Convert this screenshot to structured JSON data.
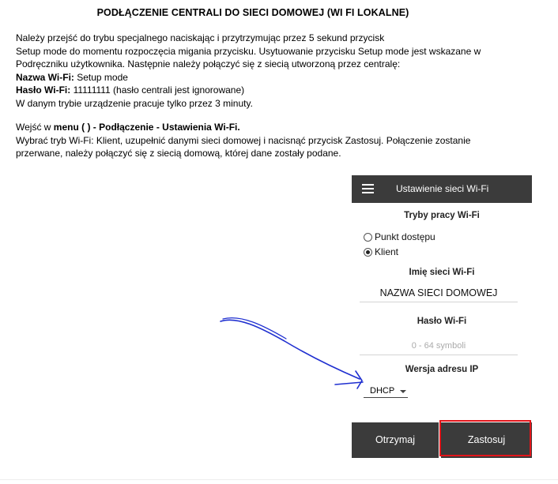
{
  "document": {
    "title": "PODŁĄCZENIE CENTRALI DO SIECI DOMOWEJ (WI FI LOKALNE)",
    "p1": {
      "line1": "Należy przejść do trybu specjalnego naciskając i przytrzymując przez 5 sekund przycisk",
      "line2": "Setup mode do momentu rozpoczęcia migania przycisku. Usytuowanie przycisku Setup mode jest wskazane w",
      "line3": "Podręczniku użytkownika. Następnie należy połączyć się z siecią utworzoną przez centralę:",
      "ssid_label": "Nazwa Wi-Fi:",
      "ssid_value": " Setup mode",
      "pass_label": "Hasło Wi-Fi:",
      "pass_value": " 11111111 (hasło centrali jest ignorowane)",
      "line6": "W danym trybie urządzenie pracuje tylko przez 3 minuty."
    },
    "p2": {
      "prefix": "Wejść w ",
      "menu": "menu ( ) - Podłączenie - Ustawienia Wi-Fi.",
      "line2": "Wybrać tryb Wi-Fi: Klient, uzupełnić danymi sieci domowej i nacisnąć przycisk Zastosuj. Połączenie zostanie",
      "line3": "przerwane, należy połączyć się z siecią domową, której dane zostały podane."
    }
  },
  "panel": {
    "header_title": "Ustawienie sieci Wi-Fi",
    "mode_label": "Tryby pracy Wi-Fi",
    "modes": [
      {
        "label": "Punkt dostępu",
        "checked": false
      },
      {
        "label": "Klient",
        "checked": true
      }
    ],
    "ssid_label": "Imię sieci Wi-Fi",
    "ssid_value": "NAZWA SIECI DOMOWEJ",
    "password_label": "Hasło Wi-Fi",
    "password_placeholder": "0 - 64 symboli",
    "ip_label": "Wersja adresu IP",
    "ip_value": "DHCP",
    "btn_get": "Otrzymaj",
    "btn_apply": "Zastosuj"
  },
  "colors": {
    "header_bg": "#3b3b3b",
    "highlight": "#e2151a",
    "annotation_arrow": "#1f2fd0"
  }
}
